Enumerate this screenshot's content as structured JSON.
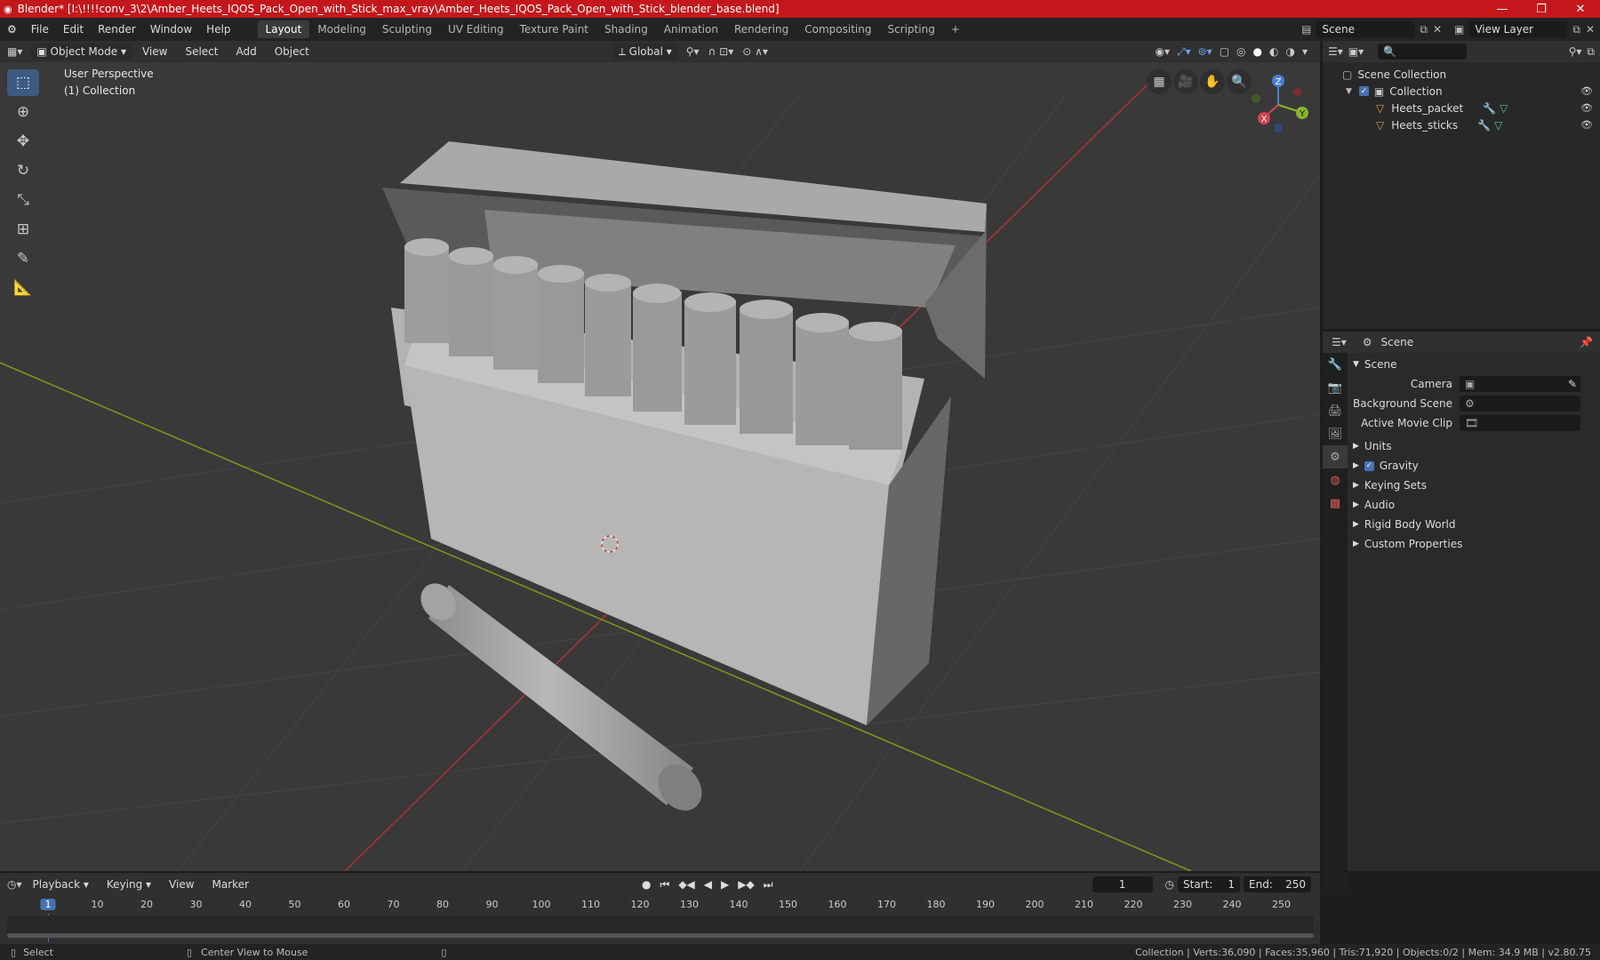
{
  "titlebar": {
    "title": "Blender* [I:\\!!!!conv_3\\2\\Amber_Heets_IQOS_Pack_Open_with_Stick_max_vray\\Amber_Heets_IQOS_Pack_Open_with_Stick_blender_base.blend]",
    "minimize": "—",
    "restore": "❐",
    "close": "✕"
  },
  "menu": [
    "File",
    "Edit",
    "Render",
    "Window",
    "Help"
  ],
  "workspaces": [
    "Layout",
    "Modeling",
    "Sculpting",
    "UV Editing",
    "Texture Paint",
    "Shading",
    "Animation",
    "Rendering",
    "Compositing",
    "Scripting"
  ],
  "scene": {
    "name": "Scene",
    "view_layer": "View Layer"
  },
  "viewport_header": {
    "mode": "Object Mode",
    "menus": [
      "View",
      "Select",
      "Add",
      "Object"
    ],
    "orientation": "Global"
  },
  "viewport": {
    "perspective": "User Perspective",
    "collection": "(1) Collection"
  },
  "gizmo": {
    "x": "X",
    "y": "Y",
    "z": "Z"
  },
  "outliner": {
    "root": "Scene Collection",
    "collection": "Collection",
    "objects": [
      "Heets_packet",
      "Heets_sticks"
    ]
  },
  "properties": {
    "header": "Scene",
    "section": "Scene",
    "camera_label": "Camera",
    "bgscene_label": "Background Scene",
    "movieclip_label": "Active Movie Clip",
    "panels": [
      "Units",
      "Gravity",
      "Keying Sets",
      "Audio",
      "Rigid Body World",
      "Custom Properties"
    ]
  },
  "timeline": {
    "menus": [
      "Playback",
      "Keying",
      "View",
      "Marker"
    ],
    "current_frame": "1",
    "start_label": "Start:",
    "start": "1",
    "end_label": "End:",
    "end": "250",
    "ticks": [
      "1",
      "10",
      "20",
      "30",
      "40",
      "50",
      "60",
      "70",
      "80",
      "90",
      "100",
      "110",
      "120",
      "130",
      "140",
      "150",
      "160",
      "170",
      "180",
      "190",
      "200",
      "210",
      "220",
      "230",
      "240",
      "250"
    ]
  },
  "status": {
    "left": "Select",
    "middle": "Center View to Mouse",
    "right": "Collection | Verts:36,090 | Faces:35,960 | Tris:71,920 | Objects:0/2 | Mem: 34.9 MB | v2.80.75"
  }
}
